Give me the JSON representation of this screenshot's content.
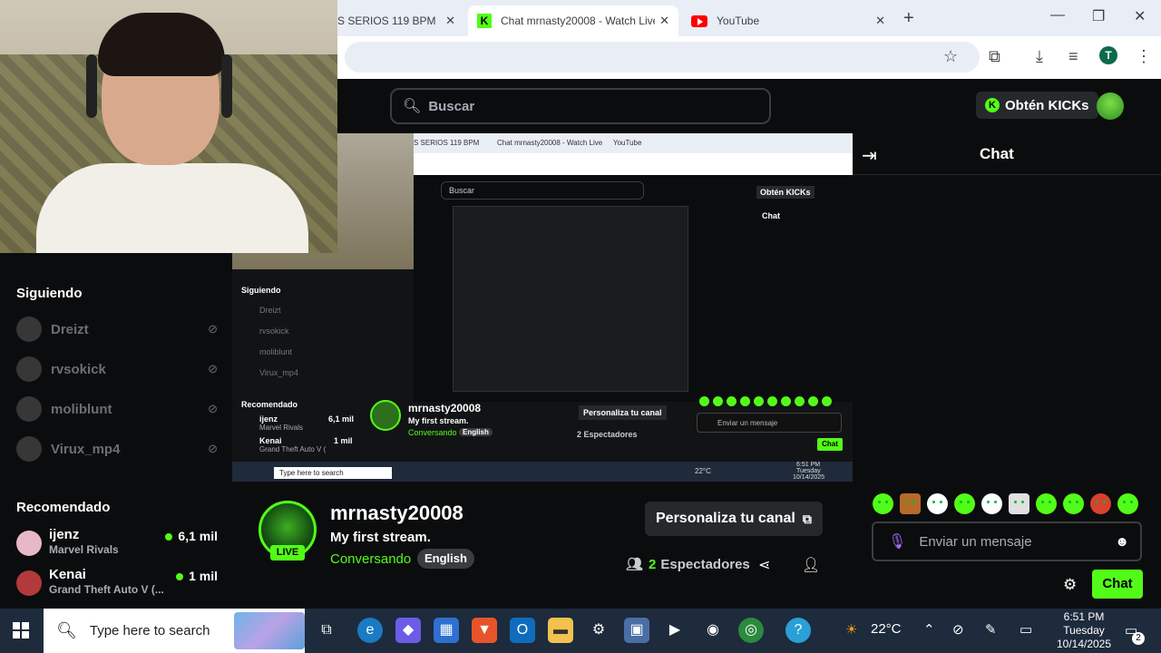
{
  "browser": {
    "tabs": [
      {
        "title": "S SERIOS 119 BPM"
      },
      {
        "title": "Chat mrnasty20008 - Watch Live"
      },
      {
        "title": "YouTube"
      }
    ],
    "new_tab": "+",
    "profile_initial": "T"
  },
  "header": {
    "search_placeholder": "Buscar",
    "kicks_button": "Obtén KICKs"
  },
  "sidebar": {
    "following_title": "Siguiendo",
    "following": [
      {
        "name": "Dreizt"
      },
      {
        "name": "rvsokick"
      },
      {
        "name": "moliblunt"
      },
      {
        "name": "Virux_mp4"
      }
    ],
    "recommended_title": "Recomendado",
    "recommended": [
      {
        "name": "ijenz",
        "category": "Marvel Rivals",
        "viewers": "6,1 mil"
      },
      {
        "name": "Kenai",
        "category": "Grand Theft Auto V (...",
        "viewers": "1 mil"
      }
    ]
  },
  "video": {
    "nested_tab1": "S SERIOS 119 BPM",
    "nested_tab2": "Chat mrnasty20008 - Watch Live",
    "nested_tab3": "YouTube",
    "nested_search": "Buscar",
    "nested_kicks": "Obtén KICKs",
    "nested_chat": "Chat",
    "nested_following": "Siguiendo",
    "nested_f1": "Dreizt",
    "nested_f2": "rvsokick",
    "nested_f3": "moliblunt",
    "nested_f4": "Virux_mp4",
    "nested_recommended": "Recomendado",
    "nested_r1": "ijenz",
    "nested_r1_cat": "Marvel Rivals",
    "nested_r1_v": "6,1 mil",
    "nested_r2": "Kenai",
    "nested_r2_cat": "Grand Theft Auto V (",
    "nested_r2_v": "1 mil",
    "nested_streamer": "mrnasty20008",
    "nested_title": "My first stream.",
    "nested_cat": "Conversando",
    "nested_lang": "English",
    "nested_personaliza": "Personaliza tu canal",
    "nested_viewers": "2 Espectadores",
    "nested_input": "Enviar un mensaje",
    "nested_send": "Chat",
    "nested_taskbar_search": "Type here to search",
    "nested_temp": "22°C",
    "nested_time": "6:51 PM",
    "nested_day": "Tuesday",
    "nested_date": "10/14/2025"
  },
  "stream": {
    "streamer": "mrnasty20008",
    "live_label": "LIVE",
    "title": "My first stream.",
    "category": "Conversando",
    "language": "English",
    "customize_button": "Personaliza tu canal",
    "viewers_count": "2",
    "viewers_label": "Espectadores"
  },
  "chat": {
    "title": "Chat",
    "input_placeholder": "Enviar un mensaje",
    "send_button": "Chat"
  },
  "taskbar": {
    "search_placeholder": "Type here to search",
    "temperature": "22°C",
    "time": "6:51 PM",
    "day": "Tuesday",
    "date": "10/14/2025",
    "notifications": "2"
  },
  "colors": {
    "accent": "#53fc18",
    "background": "#0b0c0d",
    "panel": "#26292c"
  }
}
